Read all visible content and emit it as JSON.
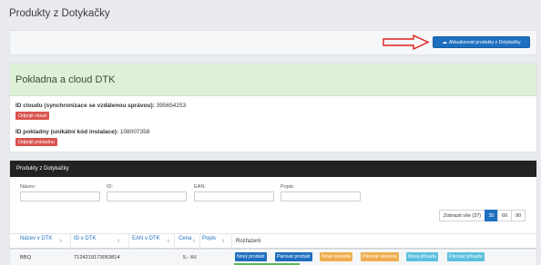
{
  "page": {
    "title": "Produkty z Dotykačky"
  },
  "toolbar": {
    "update_button": "Aktualizovat produkty z Dotykačky",
    "update_icon": "cloud-download-icon"
  },
  "cloud_panel": {
    "title": "Pokladna a cloud DTK",
    "cloud_id_label": "ID cloudu (synchronizace se vzdálenou správou):",
    "cloud_id_value": "395654253",
    "disconnect_cloud": "Odpojit cloud",
    "register_id_label": "ID pokladny (unikátní kód instalace):",
    "register_id_value": "108007358",
    "disconnect_register": "Odpojit pokladnu"
  },
  "products_panel": {
    "title": "Produkty z Dotykačky",
    "filters": {
      "name": "Název:",
      "id": "ID:",
      "ean": "EAN:",
      "desc": "Popis:"
    },
    "pager": [
      "Zobrazit vše (37)",
      "30",
      "60",
      "90"
    ],
    "pager_active": "30",
    "columns": [
      "Název v DTK",
      "ID v DTK",
      "EAN v DTK",
      "Cena",
      "Popis",
      "Rozřazení"
    ],
    "rows": [
      {
        "name": "BBQ",
        "id": "7124219173053814",
        "ean": "",
        "price": "5,- Kč",
        "desc": "",
        "actions": [
          "Nový produkt",
          "Párovat produkt",
          "Nová varianta",
          "Párovat variantu",
          "Nová přísada",
          "Párovat přísadu"
        ]
      }
    ]
  },
  "colors": {
    "accent": "#1e6fbf",
    "danger": "#d9534f",
    "warning": "#f0ad4e",
    "info": "#5bc0de",
    "success_bg": "#dff0d8",
    "arrow": "#e0211b"
  }
}
